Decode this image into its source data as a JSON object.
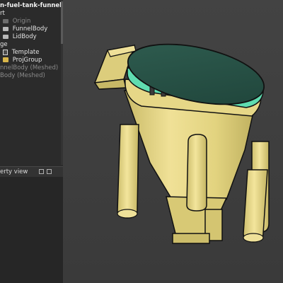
{
  "tree": {
    "root_title": "n-fuel-tank-funnel",
    "items": [
      {
        "label": "rt",
        "dim": false
      },
      {
        "label": "Origin",
        "dim": true
      },
      {
        "label": "FunnelBody",
        "dim": false
      },
      {
        "label": "LidBody",
        "dim": false
      },
      {
        "label": "ge",
        "dim": false
      },
      {
        "label": "Template",
        "dim": false
      },
      {
        "label": "ProjGroup",
        "dim": false
      },
      {
        "label": "nnelBody (Meshed)",
        "dim": true
      },
      {
        "label": "Body (Meshed)",
        "dim": true
      }
    ]
  },
  "property_panel": {
    "title": "erty view"
  },
  "model": {
    "funnel_color": "#e8d98a",
    "lid_color": "#264f44",
    "rim_color": "#5fdcb0",
    "background_color": "#3e3e3e"
  }
}
